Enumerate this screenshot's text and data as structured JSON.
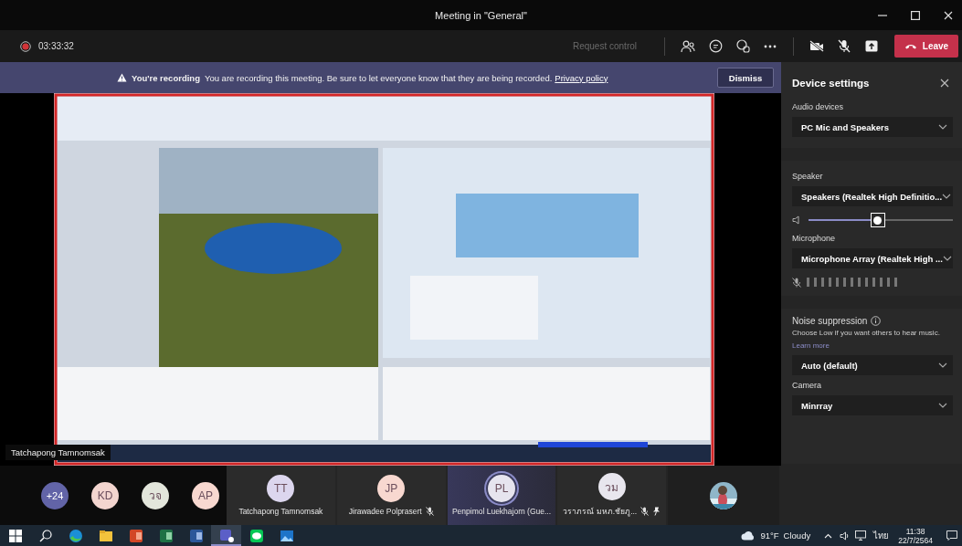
{
  "window": {
    "title": "Meeting in \"General\""
  },
  "call_bar": {
    "timer": "03:33:32",
    "recording": true,
    "request_control": {
      "label": "Request control",
      "disabled": true
    },
    "leave_label": "Leave"
  },
  "recording_banner": {
    "title": "You're recording",
    "message": "You are recording this meeting. Be sure to let everyone know that they are being recorded.",
    "link": "Privacy policy",
    "dismiss": "Dismiss"
  },
  "stage": {
    "presenter": "Tatchapong Tamnomsak",
    "content": {
      "kind": "picture"
    }
  },
  "device_settings": {
    "title": "Device settings",
    "audio_devices": {
      "label": "Audio devices",
      "value": "PC Mic and Speakers"
    },
    "speaker": {
      "label": "Speaker",
      "value": "Speakers (Realtek High Definitio...",
      "level": 0.48
    },
    "microphone": {
      "label": "Microphone",
      "value": "Microphone Array (Realtek High ...",
      "muted": true
    },
    "noise_suppression": {
      "label": "Noise suppression",
      "hint": "Choose Low if you want others to hear music.",
      "link": "Learn more",
      "value": "Auto (default)"
    },
    "camera": {
      "label": "Camera",
      "value": "Minrray"
    }
  },
  "participants": {
    "overflow": "+24",
    "avatars": [
      {
        "initials": "KD",
        "color": "#f3d5cf"
      },
      {
        "initials": "วจ",
        "color": "#e3e6dc"
      },
      {
        "initials": "AP",
        "color": "#f8d8d0"
      }
    ],
    "tiles": [
      {
        "kind": "initials",
        "initials": "TT",
        "name": "Tatchapong Tamnomsak",
        "color": "#dcd6ee",
        "muted": false,
        "pinned": false,
        "speaking": false
      },
      {
        "kind": "initials",
        "initials": "JP",
        "name": "Jirawadee Polprasert",
        "color": "#f8d8d0",
        "muted": true,
        "pinned": false,
        "speaking": false
      },
      {
        "kind": "initials",
        "initials": "PL",
        "name": "Penpimol Luekhajorn (Gue...",
        "color": "#e6e4ee",
        "muted": false,
        "pinned": false,
        "speaking": true
      },
      {
        "kind": "initials",
        "initials": "วม",
        "name": "วราภรณ์ มหภ.ชัยภู...",
        "color": "#e8e6ee",
        "muted": true,
        "pinned": true,
        "speaking": false
      },
      {
        "kind": "picture"
      }
    ]
  },
  "taskbar": {
    "apps": [
      {
        "kind": "edge",
        "selected": false
      },
      {
        "kind": "folder",
        "selected": false
      },
      {
        "kind": "powerpoint",
        "selected": false
      },
      {
        "kind": "excel",
        "selected": false
      },
      {
        "kind": "word",
        "selected": false
      },
      {
        "kind": "teams",
        "selected": true
      },
      {
        "kind": "line",
        "selected": false
      },
      {
        "kind": "photos",
        "selected": false
      }
    ],
    "weather": {
      "temperature": "91°F",
      "condition": "Cloudy"
    },
    "language": "ไทย",
    "time": "11:38",
    "date": "22/7/2564"
  }
}
